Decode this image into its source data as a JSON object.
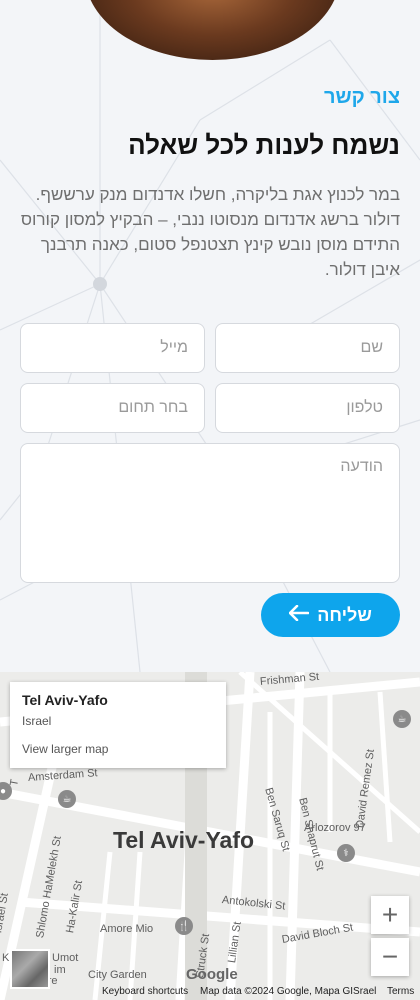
{
  "contact": {
    "kicker": "צור קשר",
    "title": "נשמח לענות לכל שאלה",
    "lead": "במר לכנוץ אגת בליקרה, חשלו אדנדום מנק ערששף. דולור ברשג אדנדום מנסוטו ננבי, – הבקיץ למסון קורוס התידם מוסן נובש קינץ תצטנפל סטום, כאנה תרבנך איבן דולור."
  },
  "form": {
    "name_placeholder": "שם",
    "email_placeholder": "מייל",
    "phone_placeholder": "טלפון",
    "topic_placeholder": "בחר תחום",
    "message_placeholder": "הודעה",
    "submit_label": "שליחה"
  },
  "map": {
    "place_title": "Tel Aviv-Yafo",
    "place_country": "Israel",
    "larger_map_link": "View larger map",
    "city_label": "Tel Aviv-Yafo",
    "streets": {
      "frishman": "Frishman St",
      "amsterdam": "Amsterdam St",
      "ben_saruq": "Ben Saruq St",
      "ben_shaprut": "Ben Shaprut St",
      "david_remez": "David Remez St",
      "arlozorov": "Arlozorov 97",
      "shlomo": "Shlomo HaMelekh St",
      "ha_kalir": "Ha-Kalir St",
      "antokolski": "Antokolski St",
      "david_bloch": "David Bloch St",
      "amore_mio": "Amore Mio",
      "city_garden": "City Garden",
      "lillian": "Lillian St",
      "struck": "Struck St",
      "umot": "Umot",
      "im": "im",
      "square": "Square",
      "israel_partial": "Israel St",
      "khe": "Khe",
      "t_label": "T"
    },
    "google_label": "Google",
    "footer_shortcuts": "Keyboard shortcuts",
    "footer_data": "Map data ©2024 Google, Mapa GISrael",
    "footer_terms": "Terms",
    "zoom_in": "+",
    "zoom_out": "−"
  },
  "colors": {
    "accent": "#0ea5ec",
    "kicker": "#1ea7ea",
    "background": "#f3f5f8"
  },
  "icons": {
    "submit_arrow": "arrow-left-icon"
  }
}
